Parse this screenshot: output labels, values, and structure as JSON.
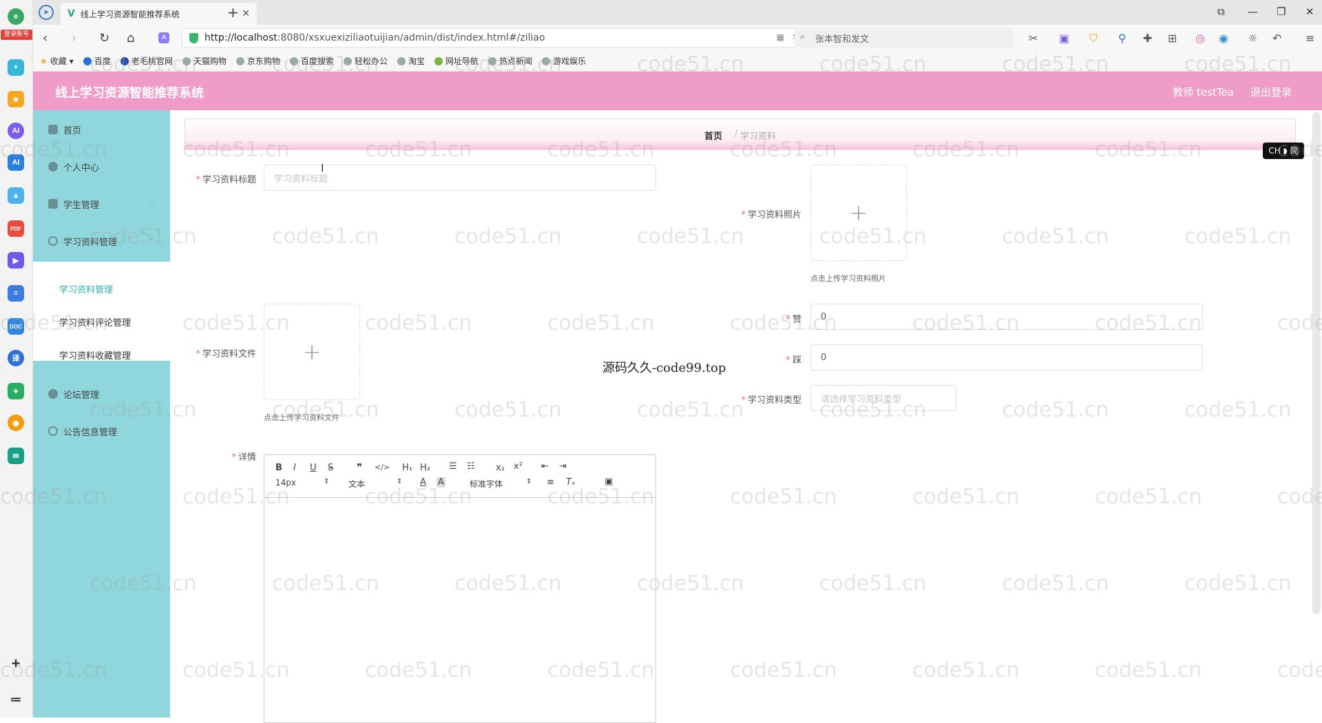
{
  "browser": {
    "dock_badge": "登录账号",
    "tab_title": "线上学习资源智能推荐系统",
    "url_host": "http://localhost",
    "url_rest": ":8080/xsxuexiziliaotuijian/admin/dist/index.html#/ziliao",
    "search_text": "张本智和发文",
    "bookmarks": [
      "收藏",
      "百度",
      "老毛桃官网",
      "天猫购物",
      "京东购物",
      "百度搜索",
      "轻松办公",
      "淘宝",
      "网址导航",
      "热点新闻",
      "游戏娱乐"
    ]
  },
  "header": {
    "title": "线上学习资源智能推荐系统",
    "user": "教师 testTea",
    "logout": "退出登录"
  },
  "sidebar": {
    "items": [
      {
        "label": "首页"
      },
      {
        "label": "个人中心"
      },
      {
        "label": "学生管理"
      },
      {
        "label": "学习资料管理"
      },
      {
        "label": "论坛管理"
      },
      {
        "label": "公告信息管理"
      }
    ],
    "subitems": [
      {
        "label": "学习资料管理"
      },
      {
        "label": "学习资料评论管理"
      },
      {
        "label": "学习资料收藏管理"
      }
    ]
  },
  "breadcrumb": {
    "home": "首页",
    "separator": "/",
    "current": "学习资料"
  },
  "form": {
    "title_label": "学习资料标题",
    "title_placeholder": "学习资料标题",
    "photo_label": "学习资料照片",
    "photo_hint": "点击上传学习资料照片",
    "file_label": "学习资料文件",
    "file_hint": "点击上传学习资料文件",
    "like_label": "赞",
    "like_value": "0",
    "dislike_label": "踩",
    "dislike_value": "0",
    "type_label": "学习资料类型",
    "type_placeholder": "请选择学习资料类型",
    "detail_label": "详情"
  },
  "editor": {
    "font_size": "14px",
    "paragraph": "文本",
    "font_family": "标准字体"
  },
  "overlay": {
    "center_text": "源码久久-code99.top",
    "watermark": "code51.cn",
    "ime": "CH ◗ 简"
  },
  "colors": {
    "header": "#ef9dc8",
    "sidebar": "#8fd6dd",
    "active_sub": "#2db7a8"
  }
}
